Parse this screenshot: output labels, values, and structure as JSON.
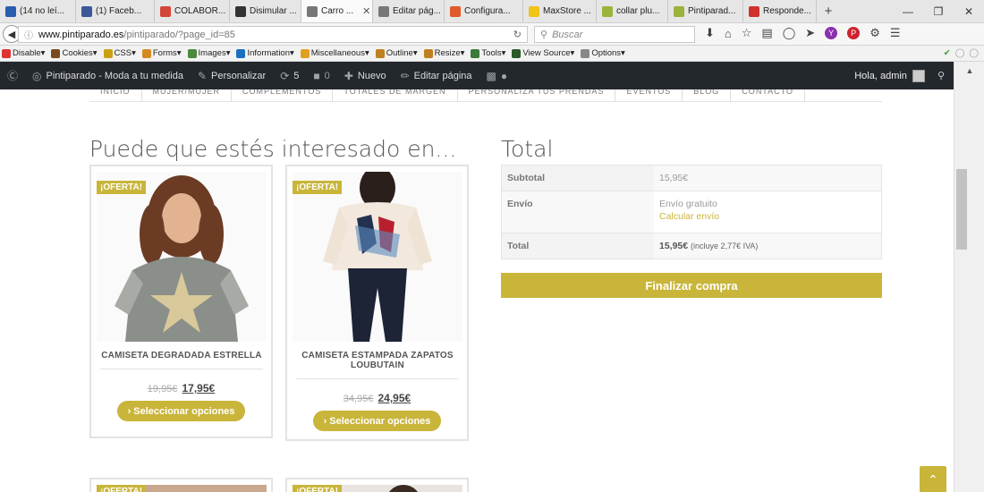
{
  "browser": {
    "tabs": [
      {
        "label": "(14 no leí...",
        "color": "#2a5db0"
      },
      {
        "label": "(1) Faceb...",
        "color": "#3b5998"
      },
      {
        "label": "COLABOR...",
        "color": "#d44638"
      },
      {
        "label": "Disimular ...",
        "color": "#333333"
      },
      {
        "label": "Carro ...",
        "color": "#777777",
        "active": true
      },
      {
        "label": "Editar pág...",
        "color": "#777777"
      },
      {
        "label": "Configura...",
        "color": "#e05a2b"
      },
      {
        "label": "MaxStore ...",
        "color": "#f0c419"
      },
      {
        "label": "collar plu...",
        "color": "#9ab33a"
      },
      {
        "label": "Pintiparad...",
        "color": "#9ab33a"
      },
      {
        "label": "Responde...",
        "color": "#d0312d"
      }
    ],
    "url_domain": "www.pintiparado.es",
    "url_path": "/pintiparado/?page_id=85",
    "search_placeholder": "Buscar"
  },
  "devbar": {
    "items": [
      "Disable▾",
      "Cookies▾",
      "CSS▾",
      "Forms▾",
      "Images▾",
      "Information▾",
      "Miscellaneous▾",
      "Outline▾",
      "Resize▾",
      "Tools▾",
      "View Source▾",
      "Options▾"
    ]
  },
  "adminbar": {
    "site": "Pintiparado - Moda a tu medida",
    "customize": "Personalizar",
    "updates": "5",
    "comments": "0",
    "new": "Nuevo",
    "edit": "Editar página",
    "greeting": "Hola, admin"
  },
  "menu": [
    "INICIO",
    "MUJER/MUJER",
    "COMPLEMENTOS",
    "TOTALES DE MARGEN",
    "PERSONALIZA TUS PRENDAS",
    "EVENTOS",
    "BLOG",
    "CONTACTO"
  ],
  "cross_sells": {
    "title": "Puede que estés interesado en...",
    "products": [
      {
        "badge": "¡OFERTA!",
        "name": "CAMISETA DEGRADADA ESTRELLA",
        "old_price": "19,95€",
        "new_price": "17,95€",
        "button": "› Seleccionar opciones"
      },
      {
        "badge": "¡OFERTA!",
        "name": "CAMISETA ESTAMPADA ZAPATOS LOUBUTAIN",
        "old_price": "34,95€",
        "new_price": "24,95€",
        "button": "› Seleccionar opciones"
      }
    ]
  },
  "totals": {
    "title": "Total",
    "subtotal_label": "Subtotal",
    "subtotal_value": "15,95€",
    "shipping_label": "Envío",
    "shipping_value": "Envío gratuito",
    "shipping_calc": "Calcular envío",
    "total_label": "Total",
    "total_value": "15,95€",
    "total_note": "(incluye 2,77€ IVA)",
    "checkout": "Finalizar compra"
  },
  "accent_color": "#c9b53a"
}
